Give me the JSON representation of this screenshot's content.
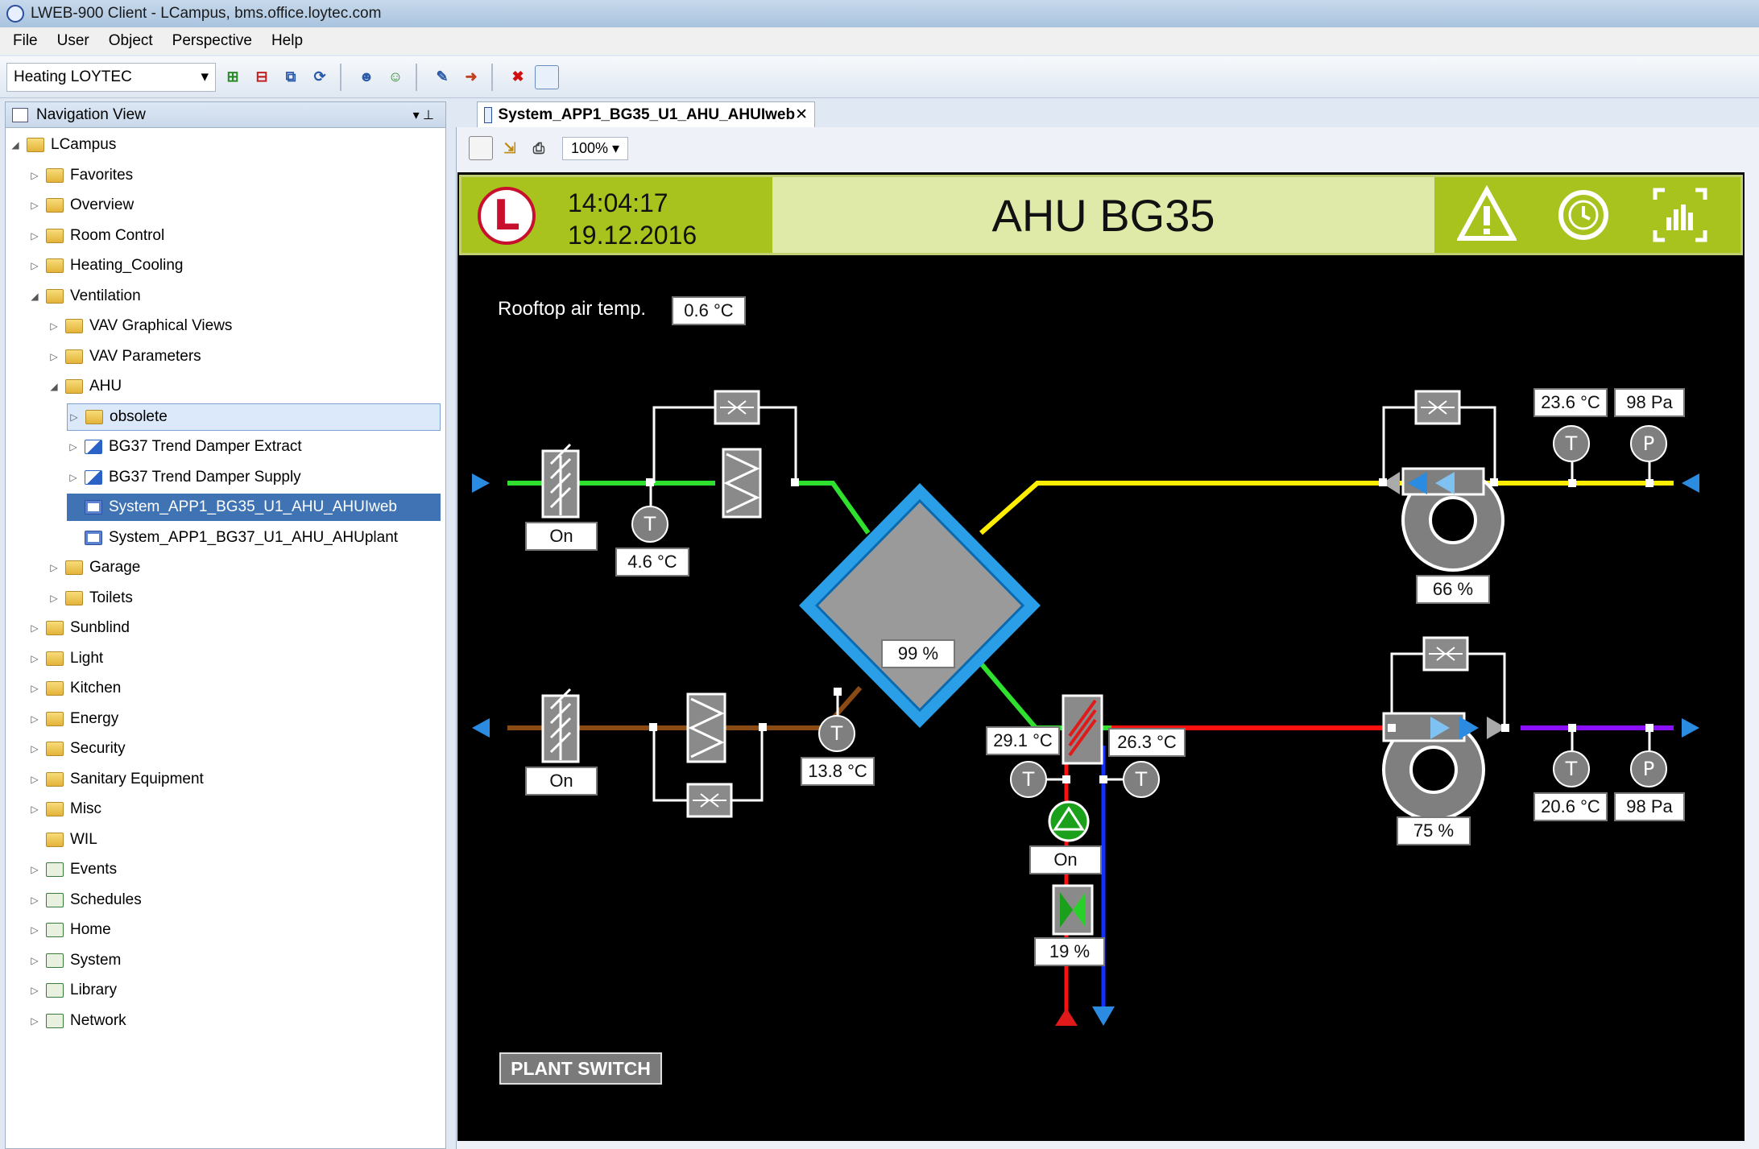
{
  "window": {
    "title": "LWEB-900 Client - LCampus, bms.office.loytec.com"
  },
  "menu": [
    "File",
    "User",
    "Object",
    "Perspective",
    "Help"
  ],
  "toolbar": {
    "perspective": "Heating LOYTEC"
  },
  "nav": {
    "title": "Navigation View",
    "items": [
      {
        "label": "LCampus",
        "level": 0,
        "arrow": "◢"
      },
      {
        "label": "Favorites",
        "level": 1,
        "arrow": "▷"
      },
      {
        "label": "Overview",
        "level": 1,
        "arrow": "▷"
      },
      {
        "label": "Room Control",
        "level": 1,
        "arrow": "▷"
      },
      {
        "label": "Heating_Cooling",
        "level": 1,
        "arrow": "▷"
      },
      {
        "label": "Ventilation",
        "level": 1,
        "arrow": "◢"
      },
      {
        "label": "VAV Graphical Views",
        "level": 2,
        "arrow": "▷"
      },
      {
        "label": "VAV Parameters",
        "level": 2,
        "arrow": "▷"
      },
      {
        "label": "AHU",
        "level": 2,
        "arrow": "◢"
      },
      {
        "label": "obsolete",
        "level": 3,
        "arrow": "▷"
      },
      {
        "label": "BG37 Trend Damper Extract",
        "level": 3,
        "arrow": "▷"
      },
      {
        "label": "BG37 Trend Damper Supply",
        "level": 3,
        "arrow": "▷"
      },
      {
        "label": "System_APP1_BG35_U1_AHU_AHUIweb",
        "level": 3,
        "arrow": ""
      },
      {
        "label": "System_APP1_BG37_U1_AHU_AHUplant",
        "level": 3,
        "arrow": ""
      },
      {
        "label": "Garage",
        "level": 2,
        "arrow": "▷"
      },
      {
        "label": "Toilets",
        "level": 2,
        "arrow": "▷"
      },
      {
        "label": "Sunblind",
        "level": 1,
        "arrow": "▷"
      },
      {
        "label": "Light",
        "level": 1,
        "arrow": "▷"
      },
      {
        "label": "Kitchen",
        "level": 1,
        "arrow": "▷"
      },
      {
        "label": "Energy",
        "level": 1,
        "arrow": "▷"
      },
      {
        "label": "Security",
        "level": 1,
        "arrow": "▷"
      },
      {
        "label": "Sanitary Equipment",
        "level": 1,
        "arrow": "▷"
      },
      {
        "label": "Misc",
        "level": 1,
        "arrow": "▷"
      },
      {
        "label": "WIL",
        "level": 1,
        "arrow": ""
      },
      {
        "label": "Events",
        "level": 1,
        "arrow": "▷"
      },
      {
        "label": "Schedules",
        "level": 1,
        "arrow": "▷"
      },
      {
        "label": "Home",
        "level": 1,
        "arrow": "▷"
      },
      {
        "label": "System",
        "level": 1,
        "arrow": "▷"
      },
      {
        "label": "Library",
        "level": 1,
        "arrow": "▷"
      },
      {
        "label": "Network",
        "level": 1,
        "arrow": "▷"
      }
    ]
  },
  "tab": {
    "label": "System_APP1_BG35_U1_AHU_AHUIweb",
    "close": "✕"
  },
  "doc_toolbar": {
    "zoom": "100%"
  },
  "hmi": {
    "time": "14:04:17",
    "date": "19.12.2016",
    "title": "AHU BG35",
    "logo_letter": "L",
    "rooftop_label": "Rooftop air temp.",
    "rooftop_temp": "0.6 °C",
    "values": {
      "fresh_damper": "On",
      "fresh_temp": "4.6 °C",
      "exhaust_damper": "On",
      "exhaust_temp": "13.8 °C",
      "recovery": "99 %",
      "extract_fan_speed": "66 %",
      "extract_temp": "23.6 °C",
      "extract_pressure": "98 Pa",
      "supply_fan_speed": "75 %",
      "supply_temp": "20.6 °C",
      "supply_pressure": "98 Pa",
      "heater_in_temp": "29.1 °C",
      "heater_out_temp": "26.3 °C",
      "pump_state": "On",
      "valve_pos": "19 %"
    },
    "plant_switch": "PLANT SWITCH",
    "sensor_t": "T",
    "sensor_p": "P"
  }
}
